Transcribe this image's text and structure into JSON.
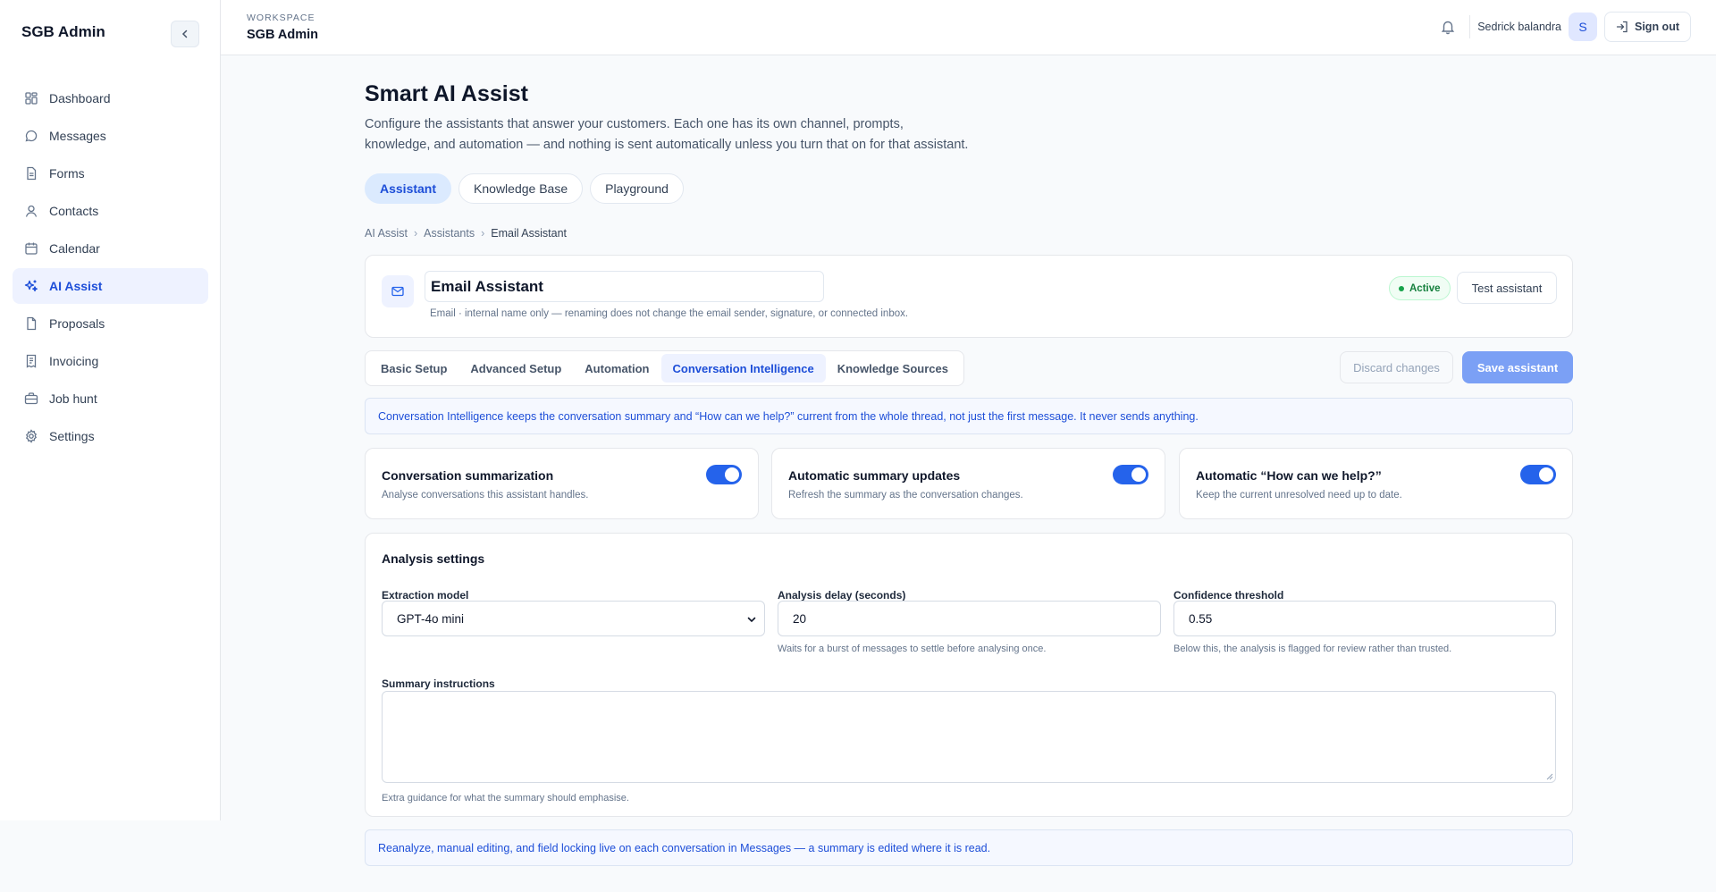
{
  "sidebar": {
    "brand": "SGB Admin",
    "items": [
      {
        "label": "Dashboard",
        "icon": "dashboard-icon"
      },
      {
        "label": "Messages",
        "icon": "message-icon"
      },
      {
        "label": "Forms",
        "icon": "document-icon"
      },
      {
        "label": "Contacts",
        "icon": "user-icon"
      },
      {
        "label": "Calendar",
        "icon": "calendar-icon"
      },
      {
        "label": "AI Assist",
        "icon": "sparkles-icon",
        "active": true
      },
      {
        "label": "Proposals",
        "icon": "file-icon"
      },
      {
        "label": "Invoicing",
        "icon": "receipt-icon"
      },
      {
        "label": "Job hunt",
        "icon": "briefcase-icon"
      },
      {
        "label": "Settings",
        "icon": "gear-icon"
      }
    ]
  },
  "topbar": {
    "kicker": "WORKSPACE",
    "title": "SGB Admin",
    "user_name": "Sedrick balandra",
    "avatar_initial": "S",
    "sign_out": "Sign out"
  },
  "page": {
    "title": "Smart AI Assist",
    "description": "Configure the assistants that answer your customers. Each one has its own channel, prompts, knowledge, and automation — and nothing is sent automatically unless you turn that on for that assistant.",
    "tabs": [
      "Assistant",
      "Knowledge Base",
      "Playground"
    ],
    "active_tab": "Assistant",
    "breadcrumb": [
      "AI Assist",
      "Assistants",
      "Email Assistant"
    ]
  },
  "assistant": {
    "name": "Email Assistant",
    "hint": "Email · internal name only — renaming does not change the email sender, signature, or connected inbox.",
    "status": "Active",
    "test_button": "Test assistant"
  },
  "subtabs": [
    "Basic Setup",
    "Advanced Setup",
    "Automation",
    "Conversation Intelligence",
    "Knowledge Sources"
  ],
  "active_subtab": "Conversation Intelligence",
  "actions": {
    "discard": "Discard changes",
    "save": "Save assistant"
  },
  "info_top": "Conversation Intelligence keeps the conversation summary and “How can we help?” current from the whole thread, not just the first message. It never sends anything.",
  "toggles": [
    {
      "title": "Conversation summarization",
      "desc": "Analyse conversations this assistant handles.",
      "on": true
    },
    {
      "title": "Automatic summary updates",
      "desc": "Refresh the summary as the conversation changes.",
      "on": true
    },
    {
      "title": "Automatic “How can we help?”",
      "desc": "Keep the current unresolved need up to date.",
      "on": true
    }
  ],
  "analysis": {
    "title": "Analysis settings",
    "model_label": "Extraction model",
    "model_value": "GPT-4o mini",
    "delay_label": "Analysis delay (seconds)",
    "delay_value": "20",
    "delay_help": "Waits for a burst of messages to settle before analysing once.",
    "confidence_label": "Confidence threshold",
    "confidence_value": "0.55",
    "confidence_help": "Below this, the analysis is flagged for review rather than trusted.",
    "instructions_label": "Summary instructions",
    "instructions_value": "",
    "instructions_help": "Extra guidance for what the summary should emphasise."
  },
  "info_bottom": "Reanalyze, manual editing, and field locking live on each conversation in Messages — a summary is edited where it is read.",
  "colors": {
    "accent": "#2563eb",
    "active_nav_bg": "#eef2ff",
    "save_button": "#7ba0f5",
    "active_badge": "#15803d"
  }
}
